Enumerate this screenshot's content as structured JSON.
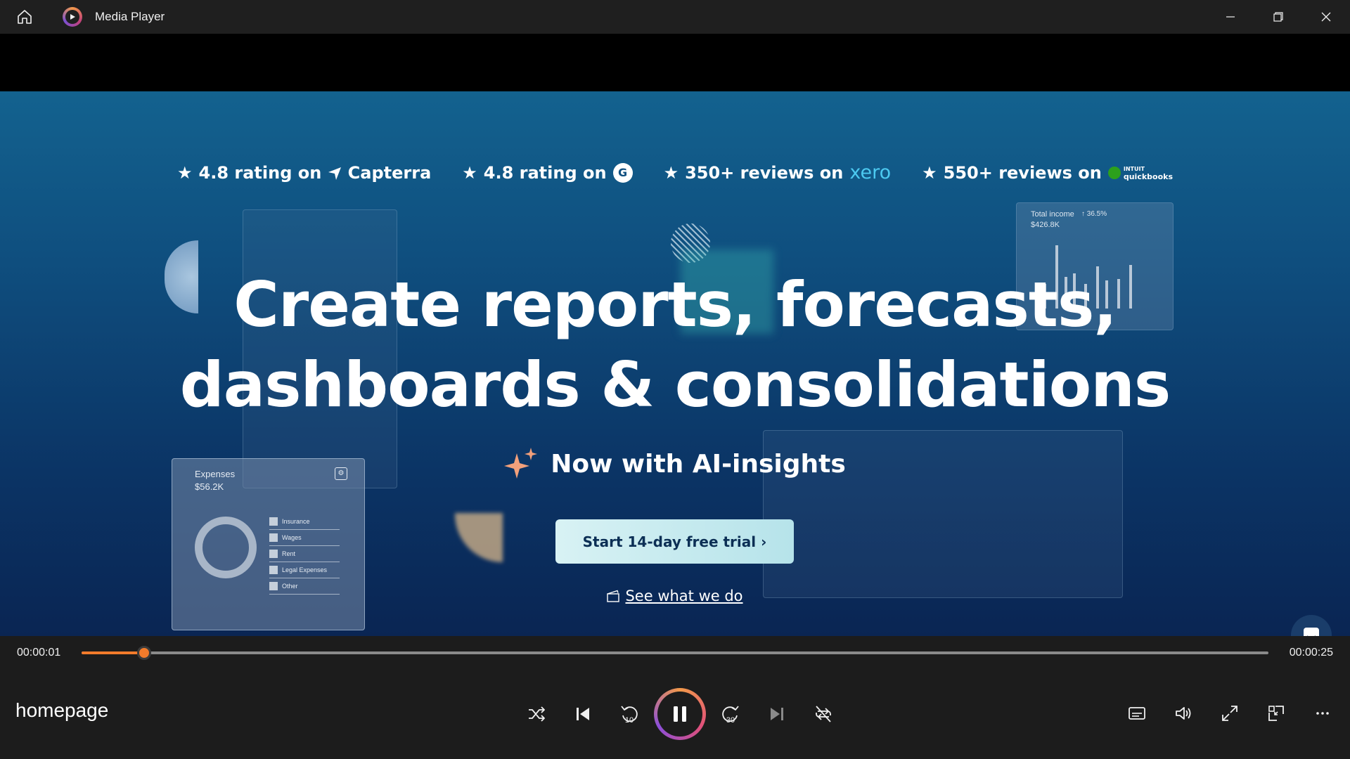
{
  "window": {
    "title": "Media Player",
    "icons": [
      "home-icon",
      "media-player-app-icon",
      "minimize-icon",
      "restore-icon",
      "close-icon"
    ]
  },
  "video": {
    "ratings": [
      {
        "text": "4.8 rating on",
        "brand": "Capterra"
      },
      {
        "text": "4.8 rating on",
        "brand": "G"
      },
      {
        "text": "350+ reviews on",
        "brand": "xero"
      },
      {
        "text": "550+ reviews on",
        "brand": "quickbooks",
        "brand_prefix": "INTUIT"
      }
    ],
    "headline_line1": "Create reports, forecasts,",
    "headline_line2": "dashboards & consolidations",
    "subheadline": "Now with AI-insights",
    "cta_label": "Start 14-day free trial ›",
    "see_link": "See what we do",
    "expenses_card": {
      "title": "Expenses",
      "value": "$56.2K",
      "items": [
        "Insurance",
        "Wages",
        "Rent",
        "Legal Expenses",
        "Other"
      ]
    },
    "income_card": {
      "title": "Total income",
      "change": "↑ 36.5%",
      "value": "$426.8K"
    }
  },
  "player": {
    "current_time": "00:00:01",
    "duration": "00:00:25",
    "progress_fraction": 0.053,
    "media_title": "homepage",
    "accent_color": "#f27b2b",
    "controls": [
      "shuffle",
      "previous",
      "rewind-10",
      "pause",
      "forward-30",
      "next",
      "repeat-off"
    ],
    "right_controls": [
      "captions",
      "volume",
      "fullscreen",
      "mini-player",
      "more-options"
    ],
    "rewind_label": "10",
    "forward_label": "30"
  }
}
